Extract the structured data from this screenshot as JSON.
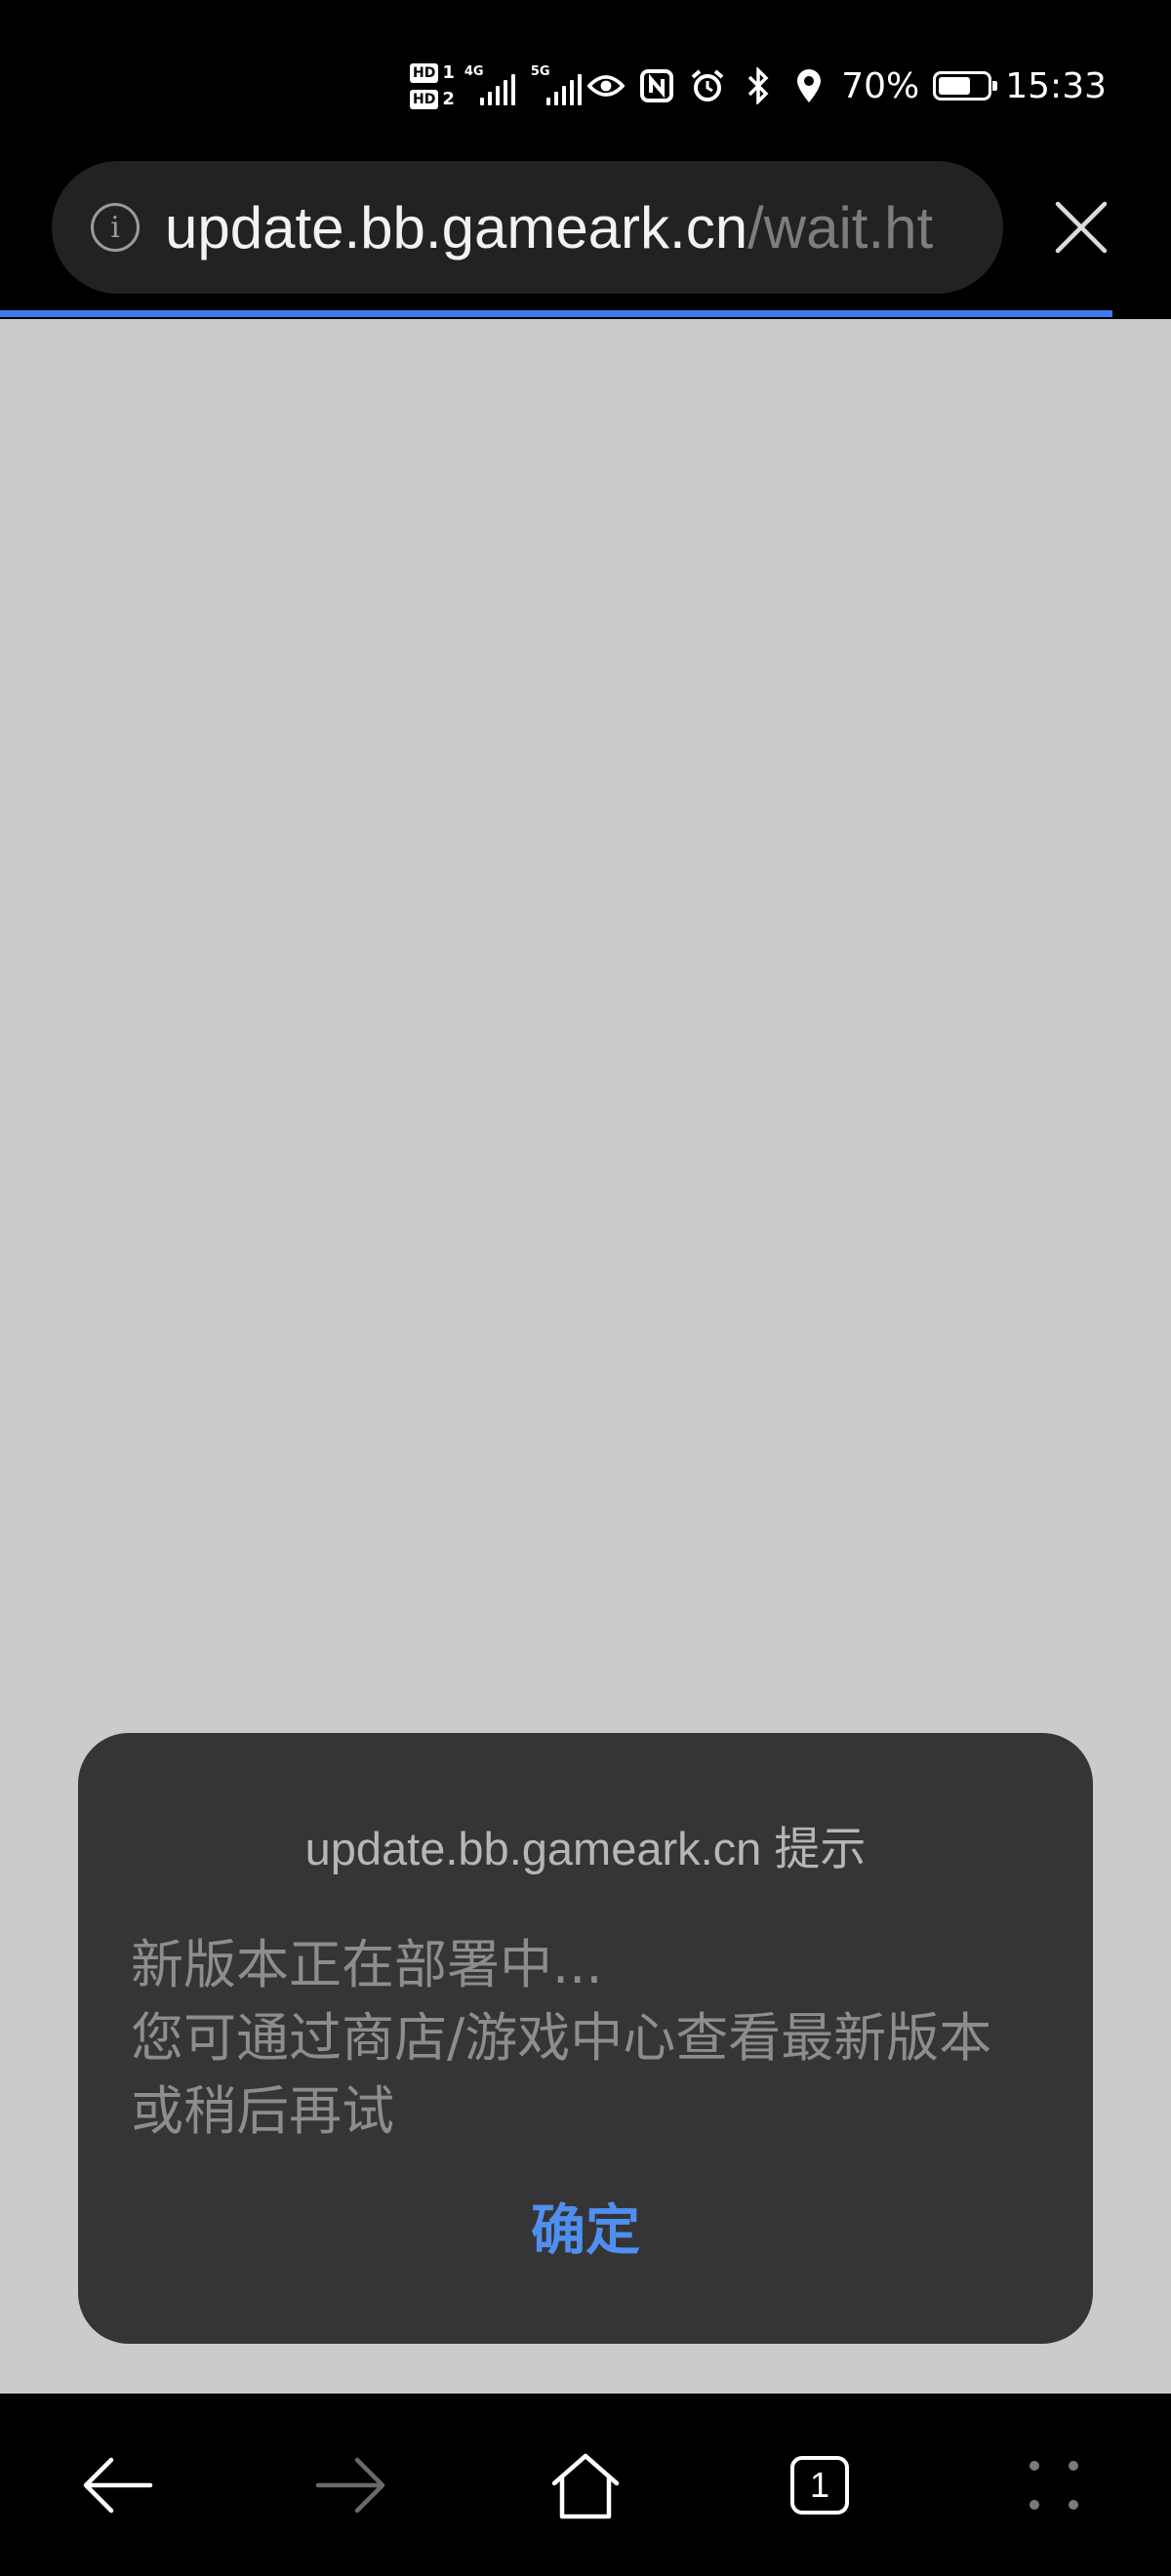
{
  "status_bar": {
    "hd1": "HD",
    "hd1_num": "1",
    "hd2": "HD",
    "hd2_num": "2",
    "net1": "4G",
    "net2": "5G",
    "battery_percent": "70%",
    "battery_level": 0.7,
    "time": "15:33",
    "icons": [
      "eye-icon",
      "nfc-icon",
      "alarm-icon",
      "bluetooth-icon",
      "location-icon",
      "battery-icon"
    ]
  },
  "browser": {
    "url_host": "update.bb.gameark.cn",
    "url_path": "/wait.ht",
    "load_progress": 0.95,
    "accent_color": "#3a7bf0",
    "tab_count": "1"
  },
  "dialog": {
    "title": "update.bb.gameark.cn 提示",
    "lines": [
      "新版本正在部署中...",
      "您可通过商店/游戏中心查看最新版本",
      "或稍后再试"
    ],
    "ok_label": "确定",
    "ok_color": "#4f8ff0"
  }
}
